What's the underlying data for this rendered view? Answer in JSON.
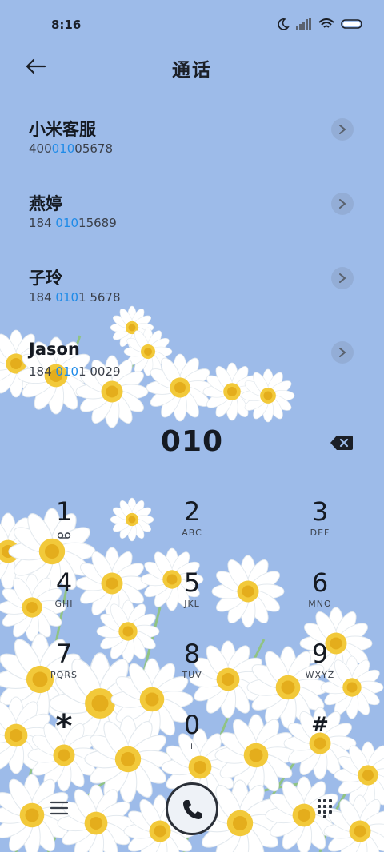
{
  "status_bar": {
    "time": "8:16",
    "icons": [
      "moon-icon",
      "signal-icon",
      "wifi-icon",
      "battery-icon"
    ]
  },
  "header": {
    "title": "通话",
    "back_icon": "back-arrow-icon"
  },
  "results": [
    {
      "name": "小米客服",
      "num_pre": "400",
      "num_hl": "010",
      "num_post": "05678"
    },
    {
      "name": "燕婷",
      "num_pre": "184 ",
      "num_hl": "010",
      "num_post": "15689"
    },
    {
      "name": "子玲",
      "num_pre": "184 ",
      "num_hl": "010",
      "num_post": "1 5678"
    },
    {
      "name": "Jason",
      "num_pre": "184 ",
      "num_hl": "010",
      "num_post": "1 0029"
    }
  ],
  "dialer": {
    "input": "010",
    "keys": [
      {
        "digit": "1",
        "letters": ""
      },
      {
        "digit": "2",
        "letters": "ABC"
      },
      {
        "digit": "3",
        "letters": "DEF"
      },
      {
        "digit": "4",
        "letters": "GHI"
      },
      {
        "digit": "5",
        "letters": "JKL"
      },
      {
        "digit": "6",
        "letters": "MNO"
      },
      {
        "digit": "7",
        "letters": "PQRS"
      },
      {
        "digit": "8",
        "letters": "TUV"
      },
      {
        "digit": "9",
        "letters": "WXYZ"
      },
      {
        "digit": "*",
        "letters": ""
      },
      {
        "digit": "0",
        "letters": "+"
      },
      {
        "digit": "#",
        "letters": ""
      }
    ]
  },
  "colors": {
    "background": "#9dbbe9",
    "highlight": "#1f8be8",
    "text": "#151a22"
  }
}
